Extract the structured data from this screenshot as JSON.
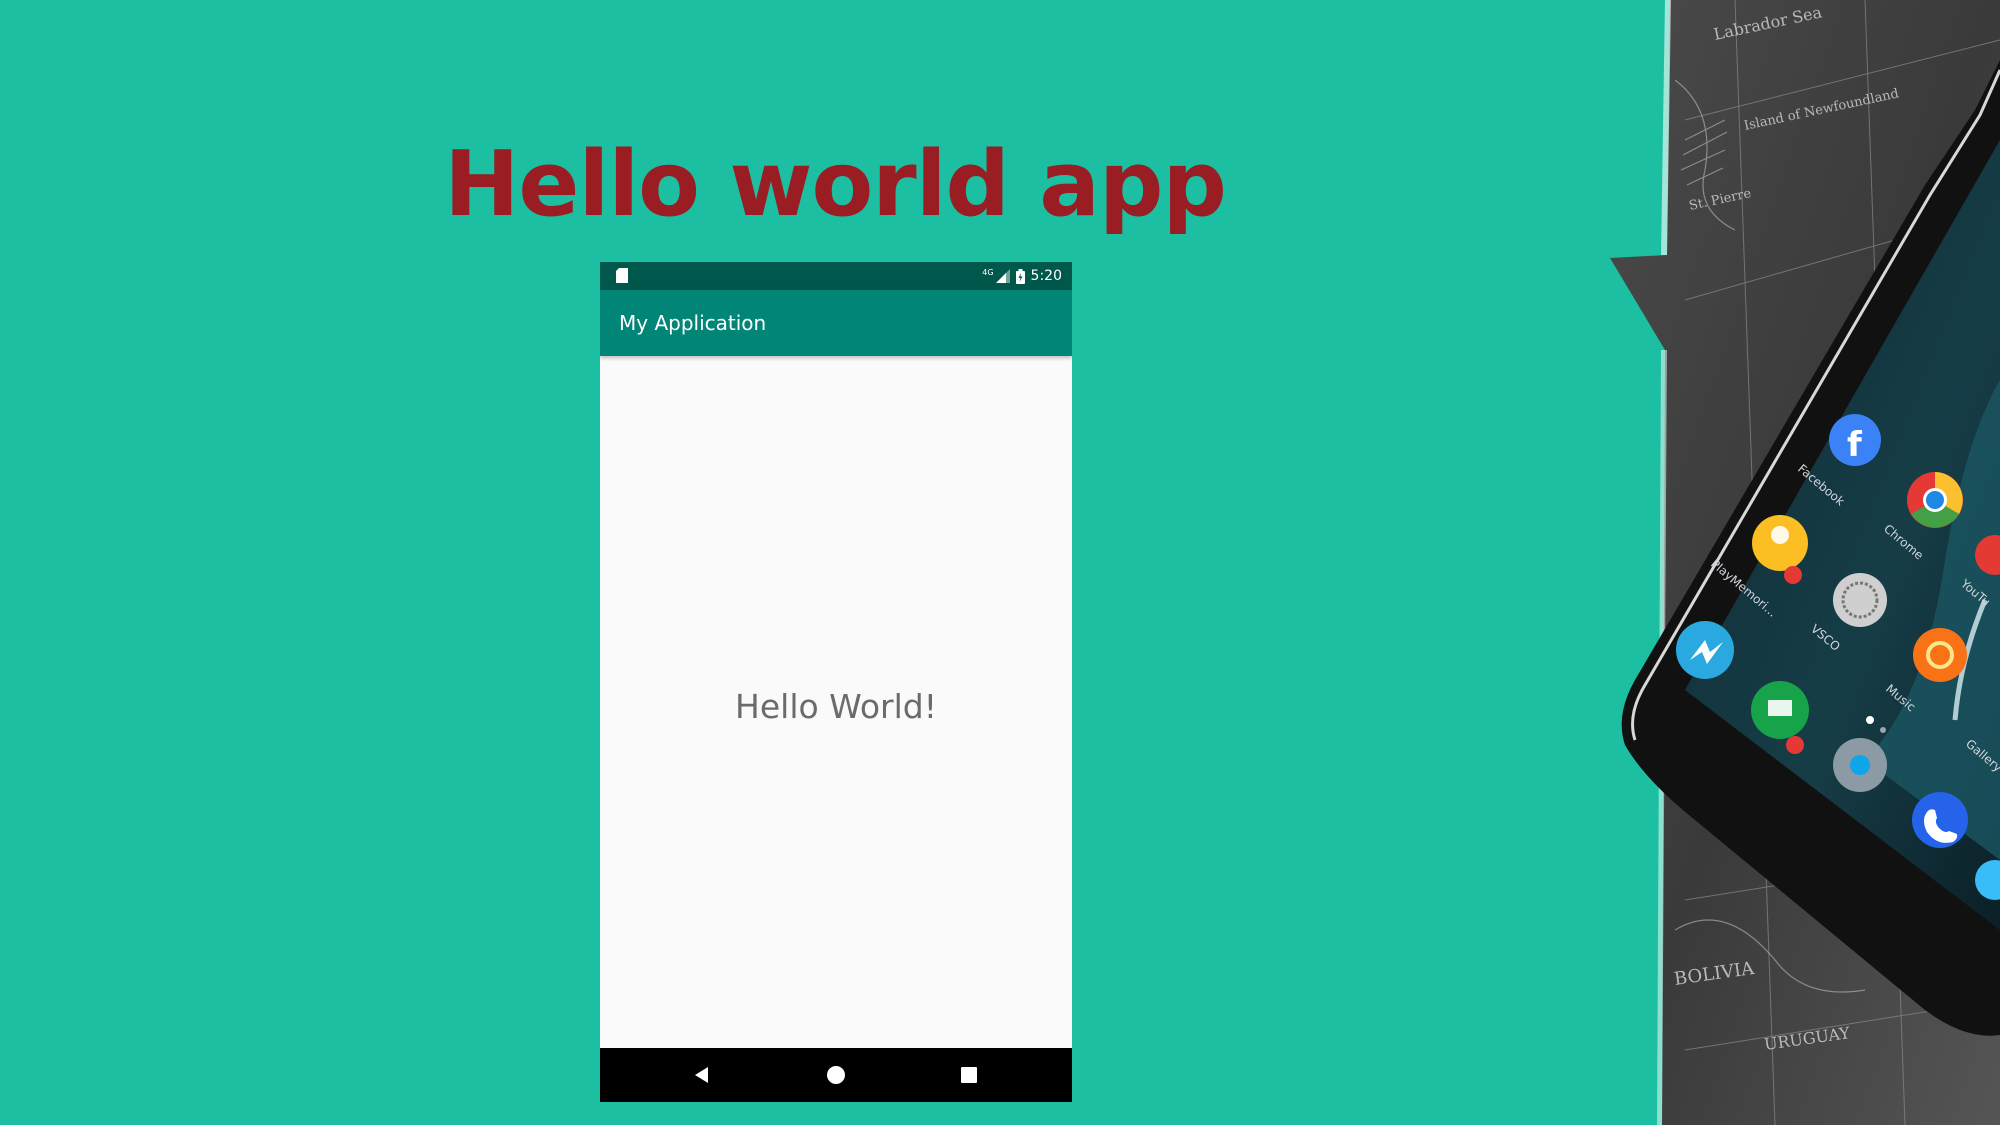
{
  "slide": {
    "title": "Hello world app"
  },
  "emulator": {
    "status_bar": {
      "network": "4G",
      "time": "5:20"
    },
    "app_bar": {
      "title": "My Application"
    },
    "content": {
      "text": "Hello World!"
    },
    "nav_bar": {
      "buttons": [
        "back",
        "home",
        "recents"
      ]
    }
  },
  "photo": {
    "app_labels": [
      "Facebook",
      "Chrome",
      "PlayMemori...",
      "VSCO",
      "YouTu",
      "Music",
      "Gallery"
    ],
    "map_labels": [
      "Labrador Sea",
      "Island of Newfoundland",
      "St. Pierre",
      "BOLIVIA",
      "URUGUAY"
    ]
  },
  "colors": {
    "background": "#1cbfa1",
    "title": "#9a1d24",
    "status_bar": "#00574b",
    "app_bar": "#008577",
    "content_bg": "#fafafa"
  }
}
